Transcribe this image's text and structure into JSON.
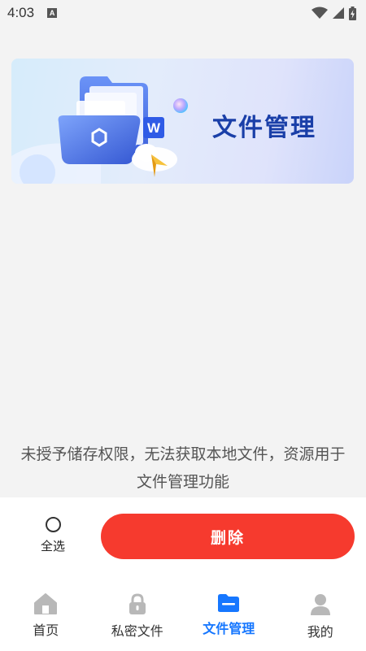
{
  "status_bar": {
    "time": "4:03",
    "notification_icon": "A",
    "icons": [
      "wifi-icon",
      "signal-icon",
      "battery-icon"
    ]
  },
  "banner": {
    "title": "文件管理",
    "art": "folder-illustration",
    "badge_letter": "W"
  },
  "permission_message": "未授予储存权限，无法获取本地文件，资源用于文件管理功能",
  "action_bar": {
    "select_all_label": "全选",
    "delete_label": "删除"
  },
  "colors": {
    "accent": "#1677ff",
    "delete": "#f63a2e",
    "banner_title": "#1a3fa8"
  },
  "nav": {
    "items": [
      {
        "label": "首页",
        "icon": "home-icon",
        "active": false
      },
      {
        "label": "私密文件",
        "icon": "lock-icon",
        "active": false
      },
      {
        "label": "文件管理",
        "icon": "folder-icon",
        "active": true
      },
      {
        "label": "我的",
        "icon": "user-icon",
        "active": false
      }
    ]
  }
}
